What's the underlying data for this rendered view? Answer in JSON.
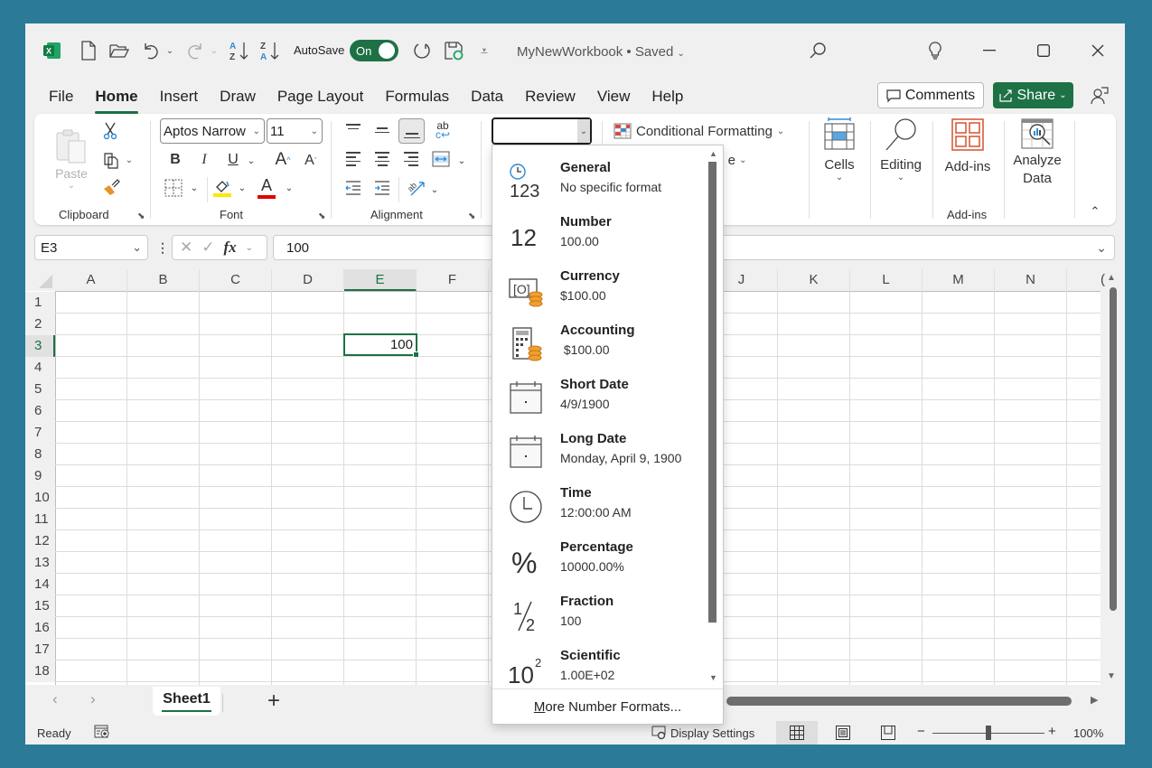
{
  "titlebar": {
    "autosave_label": "AutoSave",
    "autosave_state": "On",
    "document_title": "MyNewWorkbook • Saved",
    "icons": [
      "excel-logo",
      "new-file-icon",
      "open-folder-icon",
      "undo-icon",
      "redo-icon",
      "sort-ascending-icon",
      "sort-descending-icon",
      "refresh-icon",
      "save-sync-icon",
      "customize-qat-icon",
      "search-icon",
      "lightbulb-icon",
      "minimize-icon",
      "maximize-icon",
      "close-icon"
    ]
  },
  "menu": {
    "tabs": [
      "File",
      "Home",
      "Insert",
      "Draw",
      "Page Layout",
      "Formulas",
      "Data",
      "Review",
      "View",
      "Help"
    ],
    "active_tab": "Home",
    "comments_label": "Comments",
    "share_label": "Share"
  },
  "ribbon": {
    "clipboard": {
      "paste_label": "Paste",
      "group_label": "Clipboard"
    },
    "font": {
      "font_name": "Aptos Narrow",
      "font_size": "11",
      "bold": "B",
      "italic": "I",
      "underline": "U",
      "grow": "A",
      "shrink": "A",
      "font_color_letter": "A",
      "group_label": "Font",
      "fill_color": "#ffe600",
      "font_color": "#e00000"
    },
    "alignment": {
      "group_label": "Alignment",
      "wrap": "ab"
    },
    "number": {
      "format_value": ""
    },
    "styles": {
      "conditional_formatting": "Conditional Formatting",
      "format_table_partial": "e"
    },
    "cells": {
      "label": "Cells"
    },
    "editing": {
      "label": "Editing"
    },
    "addins": {
      "label": "Add-ins",
      "group_label": "Add-ins"
    },
    "analyze": {
      "label_line1": "Analyze",
      "label_line2": "Data"
    }
  },
  "formula_bar": {
    "name_box": "E3",
    "fx": "fx",
    "value": "100"
  },
  "grid": {
    "columns": [
      "A",
      "B",
      "C",
      "D",
      "E",
      "F",
      "",
      "",
      "",
      "J",
      "K",
      "L",
      "M",
      "N",
      "("
    ],
    "rows": [
      "1",
      "2",
      "3",
      "4",
      "5",
      "6",
      "7",
      "8",
      "9",
      "10",
      "11",
      "12",
      "13",
      "14",
      "15",
      "16",
      "17",
      "18"
    ],
    "selected_cell": "E3",
    "selected_value": "100"
  },
  "number_format_dropdown": {
    "items": [
      {
        "name": "General",
        "sample": "No specific format",
        "icon": "general-format-icon",
        "glyph": "123"
      },
      {
        "name": "Number",
        "sample": "100.00",
        "icon": "number-format-icon",
        "glyph": "12"
      },
      {
        "name": "Currency",
        "sample": "$100.00",
        "icon": "currency-icon",
        "glyph": ""
      },
      {
        "name": "Accounting",
        "sample": " $100.00",
        "icon": "accounting-icon",
        "glyph": ""
      },
      {
        "name": "Short Date",
        "sample": "4/9/1900",
        "icon": "calendar-icon",
        "glyph": ""
      },
      {
        "name": "Long Date",
        "sample": "Monday, April 9, 1900",
        "icon": "calendar-icon",
        "glyph": ""
      },
      {
        "name": "Time",
        "sample": "12:00:00 AM",
        "icon": "clock-icon",
        "glyph": ""
      },
      {
        "name": "Percentage",
        "sample": "10000.00%",
        "icon": "percent-icon",
        "glyph": "%"
      },
      {
        "name": "Fraction",
        "sample": "100",
        "icon": "fraction-icon",
        "glyph": "½"
      },
      {
        "name": "Scientific",
        "sample": "1.00E+02",
        "icon": "scientific-icon",
        "glyph": "10"
      }
    ],
    "more_label_underlined": "M",
    "more_label_rest": "ore Number Formats..."
  },
  "sheets": {
    "tabs": [
      "Sheet1"
    ],
    "active": "Sheet1"
  },
  "statusbar": {
    "ready": "Ready",
    "display_settings": "Display Settings",
    "zoom_level": "100%",
    "zoom_fraction": 0.5
  }
}
